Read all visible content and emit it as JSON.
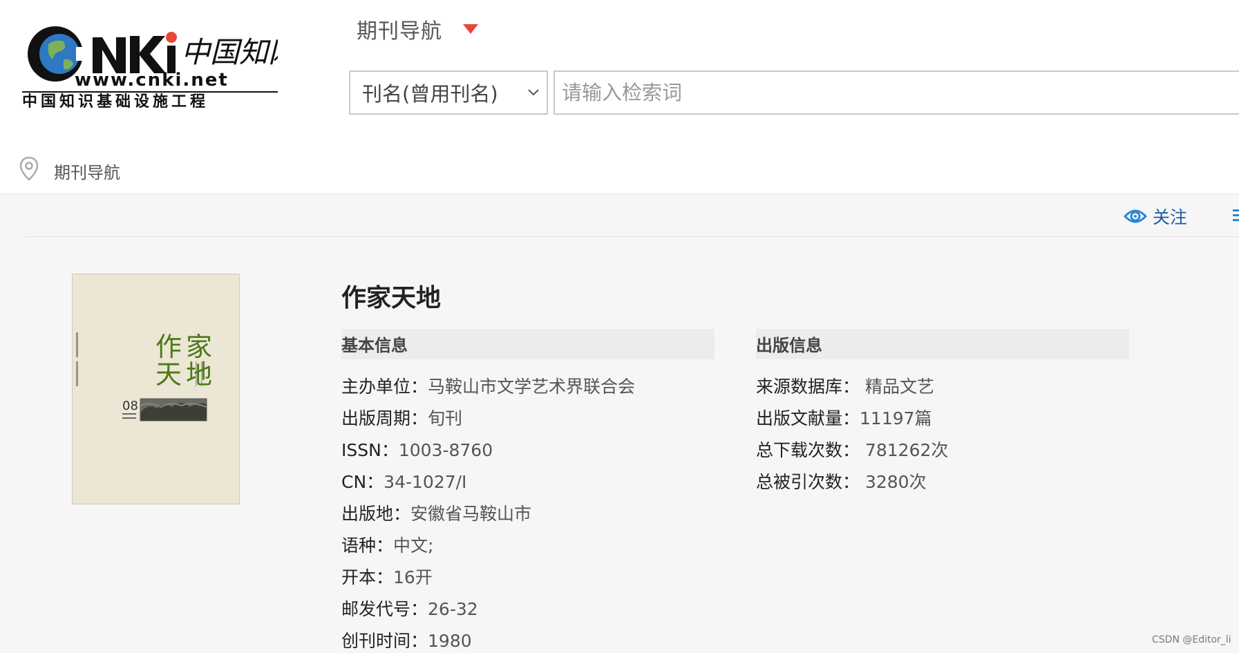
{
  "header": {
    "logo_alt": "CNKi中国知网 www.cnki.net 中国知识基础设施工程",
    "logo_brand": "CNKi",
    "logo_cn": "中国知网",
    "logo_url": "www.cnki.net",
    "logo_tagline": "中国知识基础设施工程",
    "nav_label": "期刊导航",
    "search_type": "刊名(曾用刊名)",
    "search_placeholder": "请输入检索词"
  },
  "breadcrumb": {
    "label": "期刊导航"
  },
  "toolbar": {
    "follow_label": "关注"
  },
  "journal": {
    "title": "作家天地",
    "cover": {
      "title_line1": "作家",
      "title_line2": "天地",
      "issue": "08"
    },
    "basic_info": {
      "heading": "基本信息",
      "rows": [
        {
          "label": "主办单位：",
          "value": "马鞍山市文学艺术界联合会"
        },
        {
          "label": "出版周期：",
          "value": "旬刊"
        },
        {
          "label": "ISSN：",
          "value": "1003-8760"
        },
        {
          "label": "CN：",
          "value": "34-1027/I"
        },
        {
          "label": "出版地：",
          "value": "安徽省马鞍山市"
        },
        {
          "label": "语种：",
          "value": "中文;"
        },
        {
          "label": "开本：",
          "value": "16开"
        },
        {
          "label": "邮发代号：",
          "value": "26-32"
        },
        {
          "label": "创刊时间：",
          "value": "1980"
        }
      ]
    },
    "publish_info": {
      "heading": "出版信息",
      "rows": [
        {
          "label": "来源数据库：",
          "value": " 精品文艺"
        },
        {
          "label": "出版文献量：",
          "value": "11197篇"
        },
        {
          "label": "总下载次数：",
          "value": " 781262次"
        },
        {
          "label": "总被引次数：",
          "value": " 3280次"
        }
      ]
    }
  },
  "watermark": "CSDN @Editor_li",
  "colors": {
    "accent_red": "#e8463b",
    "link_blue": "#1f5aa8",
    "cover_green": "#4a7a18"
  }
}
